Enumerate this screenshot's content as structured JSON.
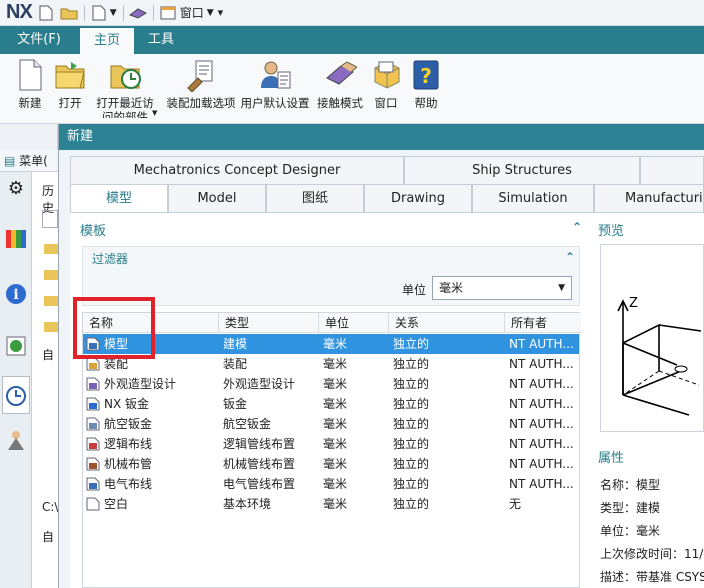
{
  "app": {
    "logo": "NX",
    "window_menu": "窗口"
  },
  "ribbon_tabs": [
    {
      "label": "文件(F)"
    },
    {
      "label": "主页"
    },
    {
      "label": "工具"
    }
  ],
  "ribbon_buttons": [
    {
      "label": "新建"
    },
    {
      "label": "打开"
    },
    {
      "label": "打开最近访",
      "label2": "问的部件"
    },
    {
      "label": "装配加载选项"
    },
    {
      "label": "用户默认设置"
    },
    {
      "label": "接触模式"
    },
    {
      "label": "窗口"
    },
    {
      "label": "帮助"
    }
  ],
  "left": {
    "menu": "菜单(",
    "history": "历史",
    "item_auto": "自",
    "path": "C:\\",
    "item_auto2": "自"
  },
  "dialog": {
    "title": "新建",
    "tabs_row1": [
      "Mechatronics Concept Designer",
      "Ship Structures"
    ],
    "tabs_row2": [
      "模型",
      "Model",
      "图纸",
      "Drawing",
      "Simulation",
      "Manufacturing"
    ],
    "templates_label": "模板",
    "filter_label": "过滤器",
    "unit_label": "单位",
    "unit_value": "毫米",
    "preview_label": "预览",
    "properties_label": "属性",
    "columns": [
      "名称",
      "类型",
      "单位",
      "关系",
      "所有者"
    ],
    "rows": [
      [
        "模型",
        "建模",
        "毫米",
        "独立的",
        "NT AUTH..."
      ],
      [
        "装配",
        "装配",
        "毫米",
        "独立的",
        "NT AUTH..."
      ],
      [
        "外观造型设计",
        "外观造型设计",
        "毫米",
        "独立的",
        "NT AUTH..."
      ],
      [
        "NX 钣金",
        "钣金",
        "毫米",
        "独立的",
        "NT AUTH..."
      ],
      [
        "航空钣金",
        "航空钣金",
        "毫米",
        "独立的",
        "NT AUTH..."
      ],
      [
        "逻辑布线",
        "逻辑管线布置",
        "毫米",
        "独立的",
        "NT AUTH..."
      ],
      [
        "机械布管",
        "机械管线布置",
        "毫米",
        "独立的",
        "NT AUTH..."
      ],
      [
        "电气布线",
        "电气管线布置",
        "毫米",
        "独立的",
        "NT AUTH..."
      ],
      [
        "空白",
        "基本环境",
        "毫米",
        "独立的",
        "无"
      ]
    ],
    "properties": [
      "名称：模型",
      "类型：建模",
      "单位：毫米",
      "上次修改时间：11/",
      "描述：带基准 CSYS"
    ]
  },
  "colors": {
    "accent": "#2a7d8c",
    "selection": "#2f93e0",
    "highlight_box": "#e0232b"
  }
}
